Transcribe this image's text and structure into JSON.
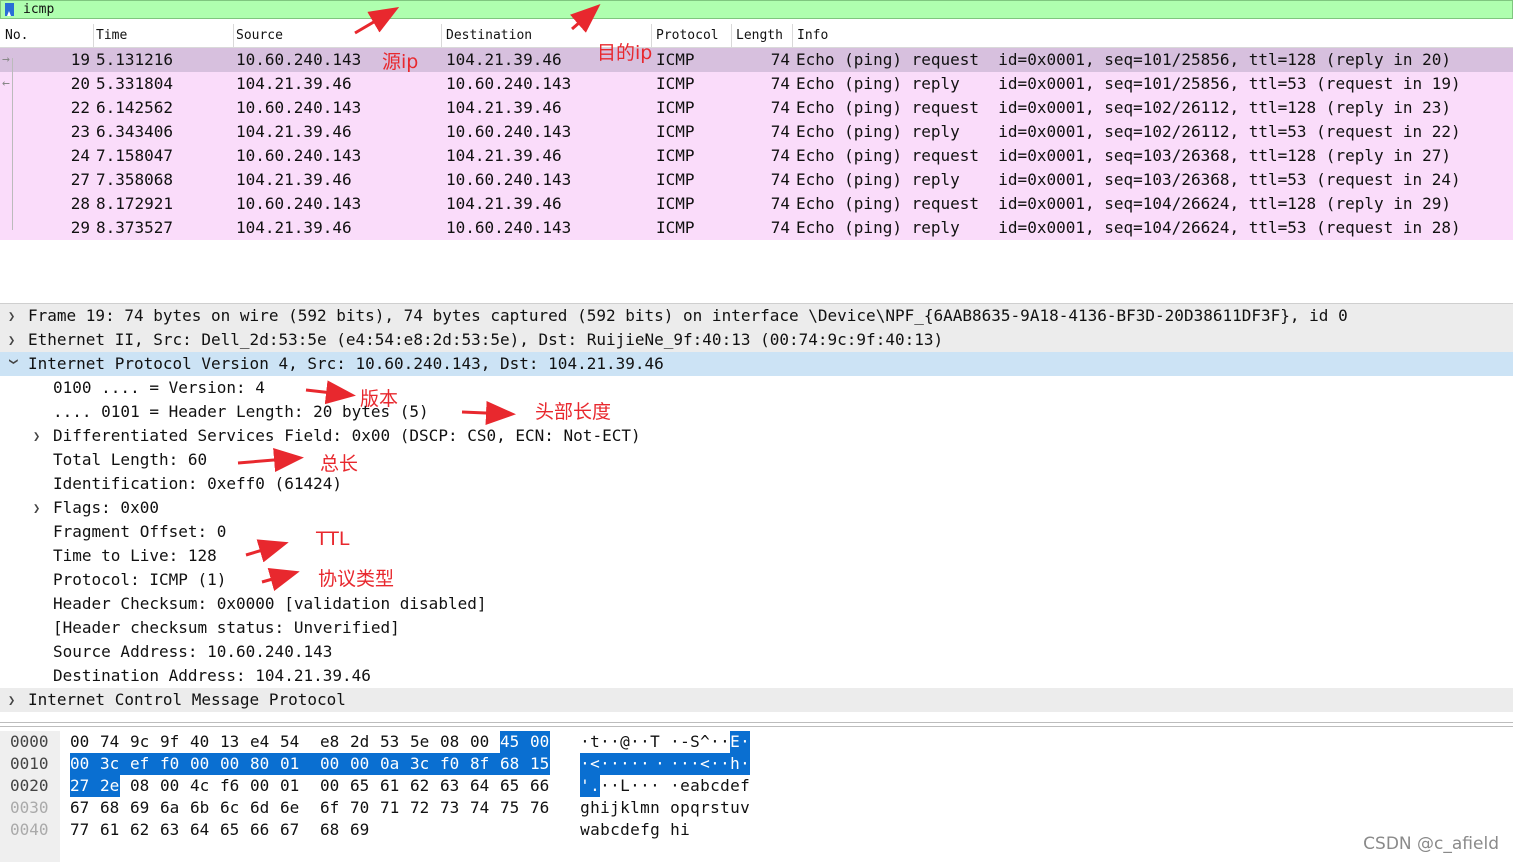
{
  "filter": {
    "value": "icmp"
  },
  "columns": {
    "no": "No.",
    "time": "Time",
    "source": "Source",
    "destination": "Destination",
    "protocol": "Protocol",
    "length": "Length",
    "info": "Info"
  },
  "packets": [
    {
      "no": "19",
      "time": "5.131216",
      "src": "10.60.240.143",
      "dst": "104.21.39.46",
      "proto": "ICMP",
      "len": "74",
      "info": "Echo (ping) request  id=0x0001, seq=101/25856, ttl=128 (reply in 20)"
    },
    {
      "no": "20",
      "time": "5.331804",
      "src": "104.21.39.46",
      "dst": "10.60.240.143",
      "proto": "ICMP",
      "len": "74",
      "info": "Echo (ping) reply    id=0x0001, seq=101/25856, ttl=53 (request in 19)"
    },
    {
      "no": "22",
      "time": "6.142562",
      "src": "10.60.240.143",
      "dst": "104.21.39.46",
      "proto": "ICMP",
      "len": "74",
      "info": "Echo (ping) request  id=0x0001, seq=102/26112, ttl=128 (reply in 23)"
    },
    {
      "no": "23",
      "time": "6.343406",
      "src": "104.21.39.46",
      "dst": "10.60.240.143",
      "proto": "ICMP",
      "len": "74",
      "info": "Echo (ping) reply    id=0x0001, seq=102/26112, ttl=53 (request in 22)"
    },
    {
      "no": "24",
      "time": "7.158047",
      "src": "10.60.240.143",
      "dst": "104.21.39.46",
      "proto": "ICMP",
      "len": "74",
      "info": "Echo (ping) request  id=0x0001, seq=103/26368, ttl=128 (reply in 27)"
    },
    {
      "no": "27",
      "time": "7.358068",
      "src": "104.21.39.46",
      "dst": "10.60.240.143",
      "proto": "ICMP",
      "len": "74",
      "info": "Echo (ping) reply    id=0x0001, seq=103/26368, ttl=53 (request in 24)"
    },
    {
      "no": "28",
      "time": "8.172921",
      "src": "10.60.240.143",
      "dst": "104.21.39.46",
      "proto": "ICMP",
      "len": "74",
      "info": "Echo (ping) request  id=0x0001, seq=104/26624, ttl=128 (reply in 29)"
    },
    {
      "no": "29",
      "time": "8.373527",
      "src": "104.21.39.46",
      "dst": "10.60.240.143",
      "proto": "ICMP",
      "len": "74",
      "info": "Echo (ping) reply    id=0x0001, seq=104/26624, ttl=53 (request in 28)"
    }
  ],
  "details": {
    "frame": "Frame 19: 74 bytes on wire (592 bits), 74 bytes captured (592 bits) on interface \\Device\\NPF_{6AAB8635-9A18-4136-BF3D-20D38611DF3F}, id 0",
    "ethernet": "Ethernet II, Src: Dell_2d:53:5e (e4:54:e8:2d:53:5e), Dst: RuijieNe_9f:40:13 (00:74:9c:9f:40:13)",
    "ipv4": "Internet Protocol Version 4, Src: 10.60.240.143, Dst: 104.21.39.46",
    "version": "0100 .... = Version: 4",
    "header_length": ".... 0101 = Header Length: 20 bytes (5)",
    "dsf": "Differentiated Services Field: 0x00 (DSCP: CS0, ECN: Not-ECT)",
    "total_length": "Total Length: 60",
    "identification": "Identification: 0xeff0 (61424)",
    "flags": "Flags: 0x00",
    "fragment_offset": "Fragment Offset: 0",
    "ttl": "Time to Live: 128",
    "protocol": "Protocol: ICMP (1)",
    "checksum": "Header Checksum: 0x0000 [validation disabled]",
    "checksum_status": "[Header checksum status: Unverified]",
    "src_addr": "Source Address: 10.60.240.143",
    "dst_addr": "Destination Address: 104.21.39.46",
    "icmp": "Internet Control Message Protocol"
  },
  "hex": [
    {
      "offset": "0000",
      "bytes": [
        "00",
        "74",
        "9c",
        "9f",
        "40",
        "13",
        "e4",
        "54",
        "e8",
        "2d",
        "53",
        "5e",
        "08",
        "00",
        "45",
        "00"
      ],
      "ascii": [
        "·",
        "t",
        "·",
        "·",
        "@",
        "·",
        "·",
        "T",
        "·",
        "-",
        "S",
        "^",
        "·",
        "·",
        "E",
        "·"
      ],
      "sel_from": 14,
      "sel_to": 15
    },
    {
      "offset": "0010",
      "bytes": [
        "00",
        "3c",
        "ef",
        "f0",
        "00",
        "00",
        "80",
        "01",
        "00",
        "00",
        "0a",
        "3c",
        "f0",
        "8f",
        "68",
        "15"
      ],
      "ascii": [
        "·",
        "<",
        "·",
        "·",
        "·",
        "·",
        "·",
        "·",
        "·",
        "·",
        "·",
        "<",
        "·",
        "·",
        "h",
        "·"
      ],
      "sel_from": 0,
      "sel_to": 15
    },
    {
      "offset": "0020",
      "bytes": [
        "27",
        "2e",
        "08",
        "00",
        "4c",
        "f6",
        "00",
        "01",
        "00",
        "65",
        "61",
        "62",
        "63",
        "64",
        "65",
        "66"
      ],
      "ascii": [
        "'",
        ".",
        "·",
        "·",
        "L",
        "·",
        "·",
        "·",
        "·",
        "e",
        "a",
        "b",
        "c",
        "d",
        "e",
        "f"
      ],
      "sel_from": 0,
      "sel_to": 1
    },
    {
      "offset": "0030",
      "bytes": [
        "67",
        "68",
        "69",
        "6a",
        "6b",
        "6c",
        "6d",
        "6e",
        "6f",
        "70",
        "71",
        "72",
        "73",
        "74",
        "75",
        "76"
      ],
      "ascii": [
        "g",
        "h",
        "i",
        "j",
        "k",
        "l",
        "m",
        "n",
        "o",
        "p",
        "q",
        "r",
        "s",
        "t",
        "u",
        "v"
      ],
      "sel_from": -1,
      "sel_to": -1
    },
    {
      "offset": "0040",
      "bytes": [
        "77",
        "61",
        "62",
        "63",
        "64",
        "65",
        "66",
        "67",
        "68",
        "69"
      ],
      "ascii": [
        "w",
        "a",
        "b",
        "c",
        "d",
        "e",
        "f",
        "g",
        "h",
        "i"
      ],
      "sel_from": -1,
      "sel_to": -1
    }
  ],
  "annotations": {
    "src_ip": "源ip",
    "dst_ip": "目的ip",
    "version": "版本",
    "header_length": "头部长度",
    "total_length": "总长",
    "ttl": "TTL",
    "protocol": "协议类型"
  },
  "watermark": "CSDN @c_afield",
  "colors": {
    "filter_bg": "#afffaf",
    "row_icmp": "#fadcfa",
    "row_selected": "#d7c0de",
    "detail_highlight": "#cce3f5",
    "hex_selected": "#0a6fd1",
    "annotation": "#e8282e"
  }
}
